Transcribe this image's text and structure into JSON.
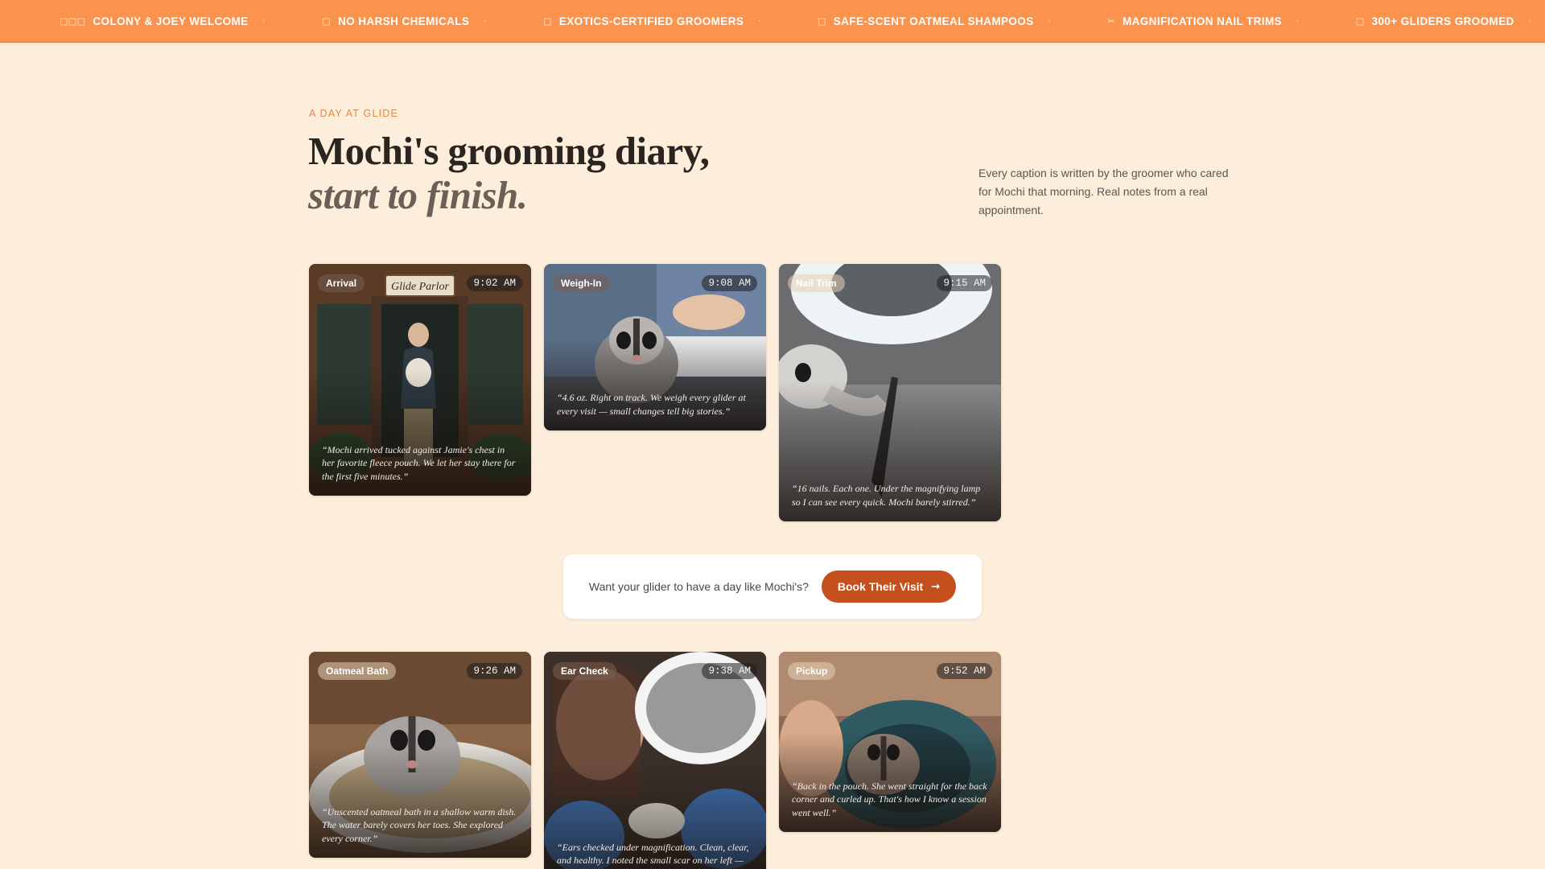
{
  "ticker": [
    {
      "icon": "three-squares-icon",
      "glyph": "□□□",
      "label": "COLONY & JOEY WELCOME"
    },
    {
      "icon": "square-icon",
      "glyph": "□",
      "label": "NO HARSH CHEMICALS"
    },
    {
      "icon": "square-icon",
      "glyph": "□",
      "label": "EXOTICS-CERTIFIED GROOMERS"
    },
    {
      "icon": "square-icon",
      "glyph": "□",
      "label": "SAFE-SCENT OATMEAL SHAMPOOS"
    },
    {
      "icon": "scissors-icon",
      "glyph": "✂",
      "label": "MAGNIFICATION NAIL TRIMS"
    },
    {
      "icon": "square-icon",
      "glyph": "□",
      "label": "300+ GLIDERS GROOMED"
    }
  ],
  "ticker_separator": "·",
  "header": {
    "eyebrow": "A DAY AT GLIDE",
    "headline_line1": "Mochi's grooming diary,",
    "headline_line2": "start to finish.",
    "intro": "Every caption is written by the groomer who cared for Mochi that morning. Real notes from a real appointment."
  },
  "cards": [
    {
      "label": "Arrival",
      "time": "9:02 AM",
      "sign": "Glide Parlor",
      "caption": "“Mochi arrived tucked against Jamie's chest in her favorite fleece pouch. We let her stay there for the first five minutes.”"
    },
    {
      "label": "Weigh-In",
      "time": "9:08 AM",
      "caption": "“4.6 oz. Right on track. We weigh every glider at every visit — small changes tell big stories.”"
    },
    {
      "label": "Nail Trim",
      "time": "9:15 AM",
      "caption": "“16 nails. Each one. Under the magnifying lamp so I can see every quick. Mochi barely stirred.”"
    },
    {
      "label": "Oatmeal Bath",
      "time": "9:26 AM",
      "caption": "“Unscented oatmeal bath in a shallow warm dish. The water barely covers her toes. She explored every corner.”"
    },
    {
      "label": "Ear Check",
      "time": "9:38 AM",
      "caption": "“Ears checked under magnification. Clean, clear, and healthy. I noted the small scar on her left — Jamie already knew about it.”"
    },
    {
      "label": "Pickup",
      "time": "9:52 AM",
      "caption": "“Back in the pouch. She went straight for the back corner and curled up. That's how I know a session went well.”"
    }
  ],
  "booking": {
    "prompt": "Want your glider to have a day like Mochi's?",
    "button_label": "Book Their Visit",
    "button_icon": "arrow-right-icon",
    "button_glyph": "→"
  },
  "colors": {
    "page_bg": "#fdeedb",
    "ticker_bg": "#f9934d",
    "accent": "#e3874a",
    "button": "#c4501e"
  }
}
